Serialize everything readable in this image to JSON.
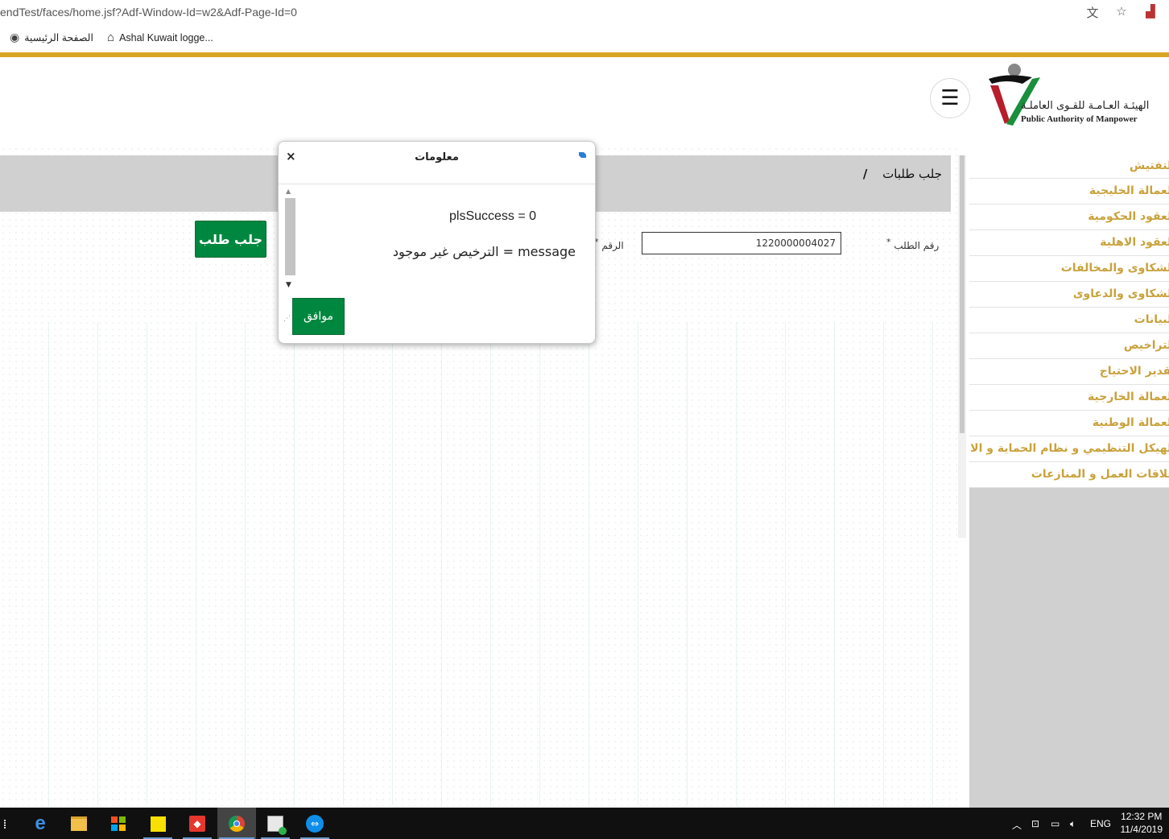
{
  "browser": {
    "url": "endTest/faces/home.jsf?Adf-Window-Id=w2&Adf-Page-Id=0",
    "bookmarks": [
      "الصفحة الرئيسية",
      "Ashal Kuwait logge..."
    ]
  },
  "header": {
    "logo_ar": "الهيئـة العـامـة للقـوى العاملـة",
    "logo_en": "Public Authority of Manpower",
    "menu_icon": "hamburger-icon"
  },
  "breadcrumb": {
    "current": "جلب طلبات",
    "separator": "/"
  },
  "form": {
    "request_number_label": "رقم الطلب",
    "request_number_value": "1220000004027",
    "second_label": "الرقم",
    "fetch_button": "جلب طلب"
  },
  "sidebar": {
    "items": [
      "التفتيش",
      "العمالة الخليجية",
      "العقود الحكومية",
      "العقود الاهلية",
      "الشكاوى والمخالفات",
      "الشكاوى والدعاوى",
      "البيانات",
      "التراخيص",
      "تقدير الاحتياج",
      "العمالة الخارجية",
      "العمالة الوطنية",
      "الهيكل التنظيمي و نظام الحماية و الامن",
      "علاقات العمل و المنازعات"
    ]
  },
  "dialog": {
    "title": "معلومات",
    "line1": "plsSuccess = 0",
    "line2": "message = الترخيص غير موجود",
    "ok_button": "موافق",
    "close_symbol": "×"
  },
  "taskbar": {
    "language": "ENG",
    "time": "12:32 PM",
    "date": "11/4/2019"
  },
  "colors": {
    "gold": "#d8a526",
    "green": "#00873f",
    "sidebar_text": "#c9a23c"
  }
}
